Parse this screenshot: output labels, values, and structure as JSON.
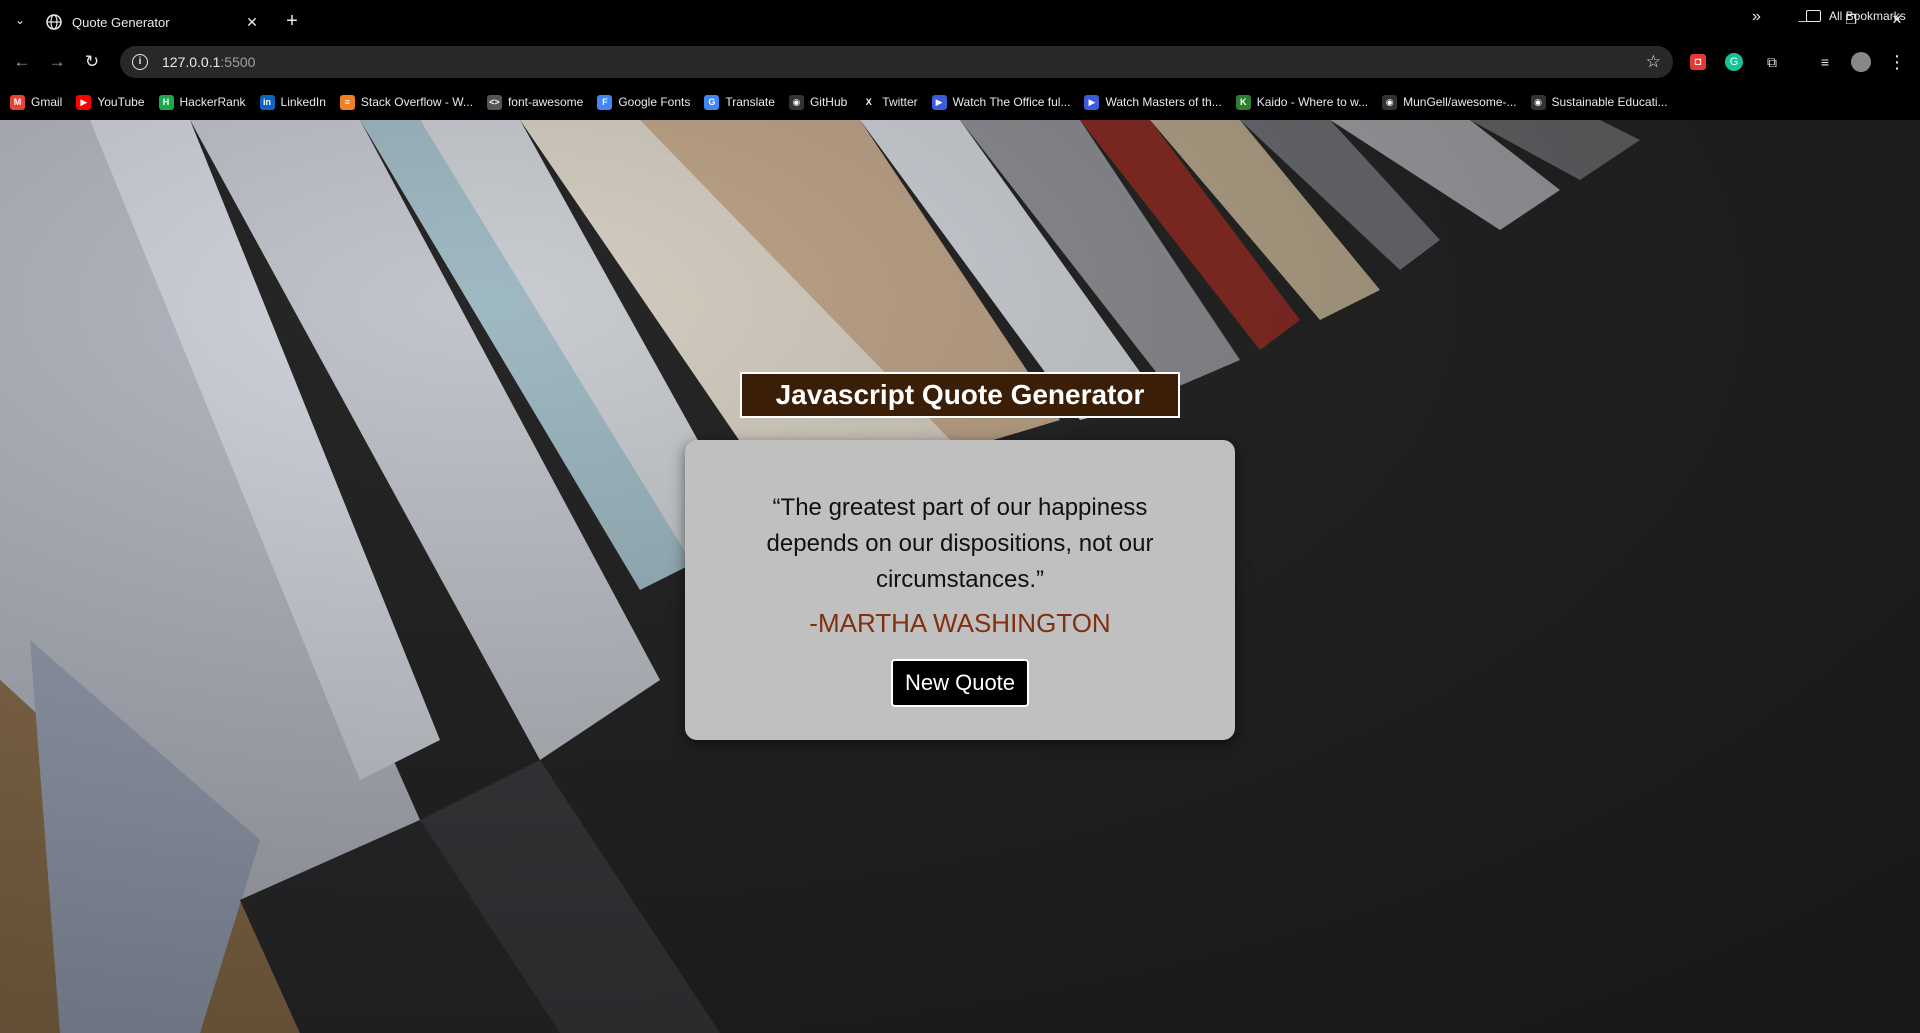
{
  "browser": {
    "tab_title": "Quote Generator",
    "url_host": "127.0.0.1",
    "url_port": ":5500",
    "bookmarks": [
      {
        "label": "Gmail",
        "icon": "gmail-icon",
        "color": "#ea4335",
        "glyph": "M"
      },
      {
        "label": "YouTube",
        "icon": "youtube-icon",
        "color": "#ff0000",
        "glyph": "▶"
      },
      {
        "label": "HackerRank",
        "icon": "hackerrank-icon",
        "color": "#1ba94c",
        "glyph": "H"
      },
      {
        "label": "LinkedIn",
        "icon": "linkedin-icon",
        "color": "#0a66c2",
        "glyph": "in"
      },
      {
        "label": "Stack Overflow - W...",
        "icon": "stackoverflow-icon",
        "color": "#f48024",
        "glyph": "≡"
      },
      {
        "label": "font-awesome",
        "icon": "code-icon",
        "color": "#555555",
        "glyph": "<>"
      },
      {
        "label": "Google Fonts",
        "icon": "google-fonts-icon",
        "color": "#4285f4",
        "glyph": "F"
      },
      {
        "label": "Translate",
        "icon": "translate-icon",
        "color": "#4285f4",
        "glyph": "G"
      },
      {
        "label": "GitHub",
        "icon": "github-icon",
        "color": "#333333",
        "glyph": "◉"
      },
      {
        "label": "Twitter",
        "icon": "x-icon",
        "color": "#000000",
        "glyph": "X"
      },
      {
        "label": "Watch The Office ful...",
        "icon": "video-icon",
        "color": "#3b5bdb",
        "glyph": "▶"
      },
      {
        "label": "Watch Masters of th...",
        "icon": "video-icon",
        "color": "#3b5bdb",
        "glyph": "▶"
      },
      {
        "label": "Kaido - Where to w...",
        "icon": "kaido-icon",
        "color": "#2e7d32",
        "glyph": "K"
      },
      {
        "label": "MunGell/awesome-...",
        "icon": "github-icon",
        "color": "#333333",
        "glyph": "◉"
      },
      {
        "label": "Sustainable Educati...",
        "icon": "github-icon",
        "color": "#333333",
        "glyph": "◉"
      }
    ],
    "all_bookmarks_label": "All Bookmarks"
  },
  "page": {
    "heading": "Javascript Quote Generator",
    "quote": "“The greatest part of our happiness depends on our dispositions, not our circumstances.”",
    "author": "-MARTHA WASHINGTON",
    "button_label": "New Quote"
  },
  "colors": {
    "heading_bg": "#3a1e07",
    "card_bg": "#c0c0c0",
    "author": "#80300f"
  }
}
